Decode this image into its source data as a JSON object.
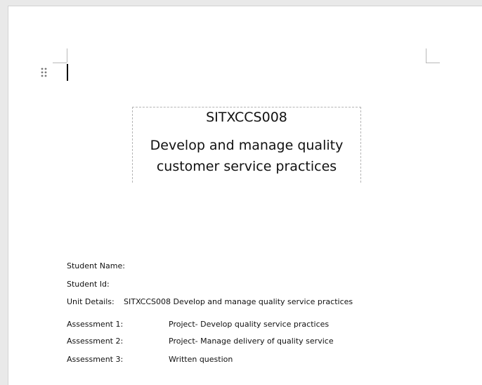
{
  "document": {
    "unit_code": "SITXCCS008",
    "unit_title_line1": "Develop and manage quality",
    "unit_title_line2": "customer service practices"
  },
  "details": {
    "student_name_label": "Student Name:",
    "student_id_label": "Student Id:",
    "unit_details_label": "Unit Details:",
    "unit_details_value": "SITXCCS008 Develop and manage quality service practices",
    "assessments": [
      {
        "label": "Assessment 1:",
        "value": "Project- Develop quality service practices"
      },
      {
        "label": "Assessment 2:",
        "value": "Project- Manage delivery of quality service"
      },
      {
        "label": "Assessment 3:",
        "value": "Written question"
      }
    ]
  },
  "icons": {
    "move_handle": "drag-handle-icon"
  }
}
